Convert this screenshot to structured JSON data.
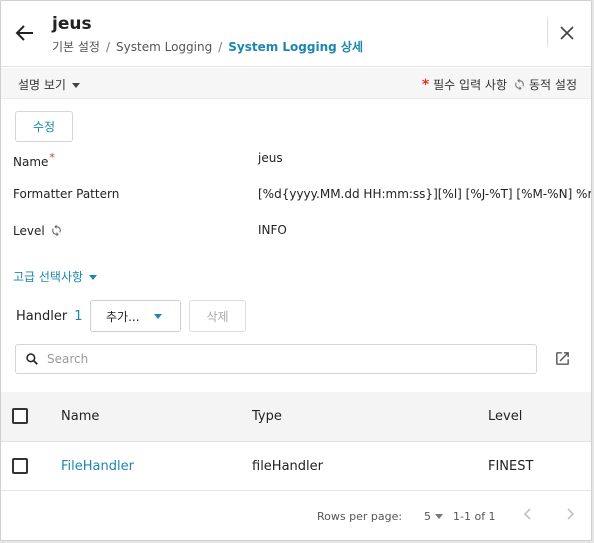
{
  "header": {
    "title": "jeus",
    "breadcrumb": [
      "기본 설정",
      "System Logging",
      "System Logging 상세"
    ],
    "breadcrumb_separator": "/"
  },
  "subbar": {
    "description_toggle": "설명 보기",
    "required_legend": "필수 입력 사항",
    "dynamic_legend": "동적 설정"
  },
  "toolbar": {
    "edit_label": "수정"
  },
  "fields": [
    {
      "label": "Name",
      "required": true,
      "value": "jeus"
    },
    {
      "label": "Formatter Pattern",
      "value": "[%d{yyyy.MM.dd HH:mm:ss}][%l] [%J-%T] [%M-%N] %m"
    },
    {
      "label": "Level",
      "dynamic": true,
      "value": "INFO"
    }
  ],
  "advanced": {
    "label": "고급 선택사항"
  },
  "handler": {
    "label": "Handler",
    "count": "1",
    "add_label": "추가...",
    "delete_label": "삭제",
    "search_placeholder": "Search",
    "columns": [
      "Name",
      "Type",
      "Level"
    ],
    "rows": [
      {
        "name": "FileHandler",
        "type": "fileHandler",
        "level": "FINEST"
      }
    ],
    "pagination": {
      "rows_per_page_label": "Rows per page:",
      "rows_per_page": "5",
      "range": "1-1 of 1"
    }
  },
  "colors": {
    "accent": "#1d87ad",
    "required": "#e0342b"
  }
}
